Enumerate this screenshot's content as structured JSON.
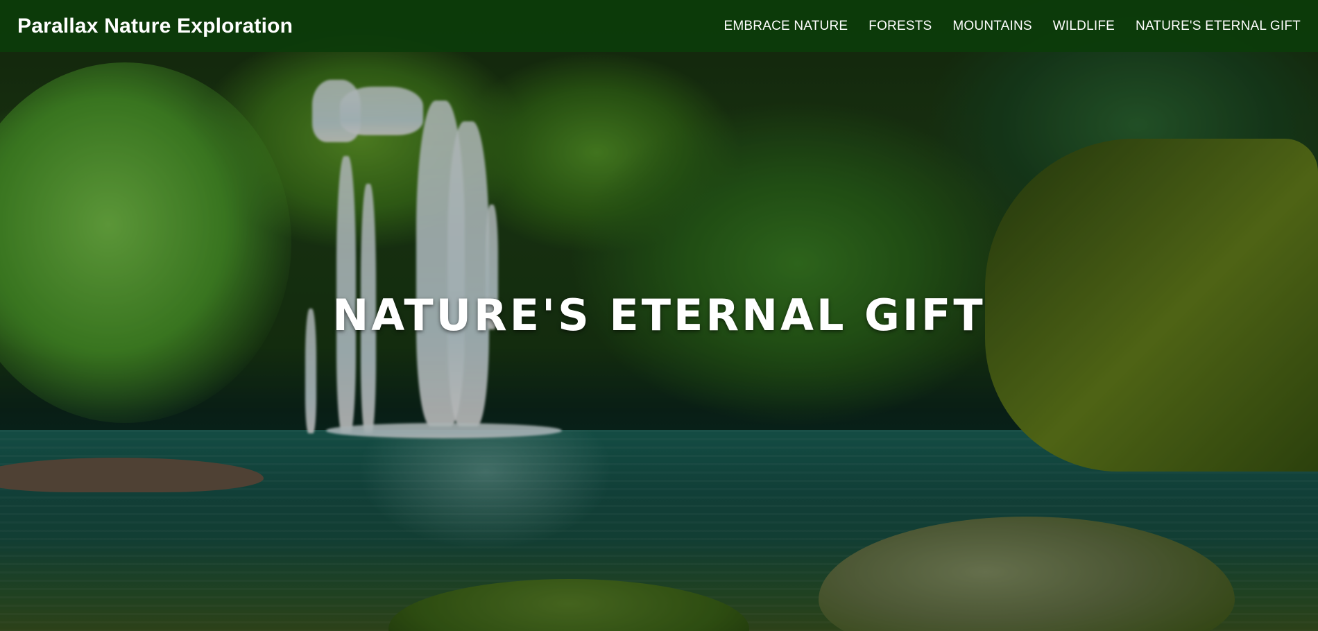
{
  "navbar": {
    "brand": "Parallax Nature Exploration",
    "links": [
      {
        "label": "EMBRACE NATURE"
      },
      {
        "label": "FORESTS"
      },
      {
        "label": "MOUNTAINS"
      },
      {
        "label": "WILDLIFE"
      },
      {
        "label": "NATURE'S ETERNAL GIFT"
      }
    ]
  },
  "hero": {
    "title": "NATURE'S ETERNAL GIFT"
  },
  "colors": {
    "navbar_bg": "#0c3c0a",
    "text": "#ffffff"
  }
}
